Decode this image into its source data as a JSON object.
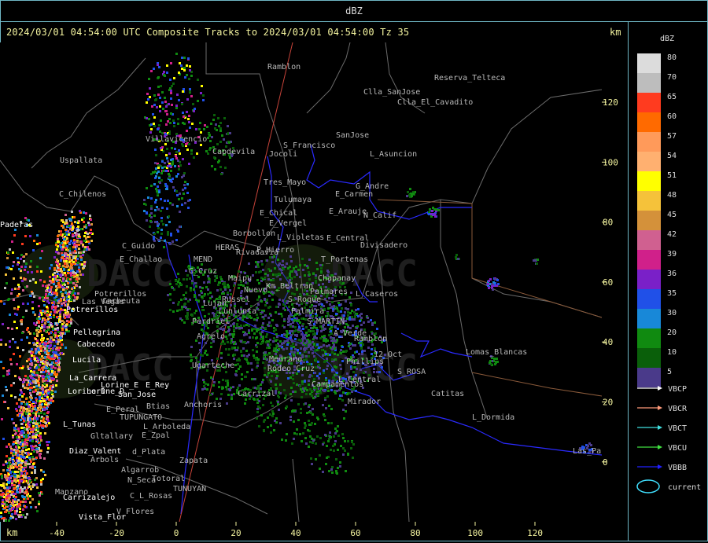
{
  "header": {
    "title": "dBZ"
  },
  "caption": "2024/03/01 04:54:00 UTC Composite Tracks to 2024/03/01 04:54:00 Tz 35",
  "units_top": "km",
  "units_bottom": "km",
  "axis_y_ticks": [
    "120",
    "100",
    "80",
    "60",
    "40",
    "20",
    "0"
  ],
  "axis_x_ticks": [
    "-40",
    "-20",
    "0",
    "20",
    "40",
    "60",
    "80",
    "100",
    "120"
  ],
  "legend": {
    "title": "dBZ",
    "scale": [
      {
        "label": "80",
        "color": "#dcdcdc"
      },
      {
        "label": "70",
        "color": "#bdbdbd"
      },
      {
        "label": "65",
        "color": "#ff3b1f"
      },
      {
        "label": "60",
        "color": "#ff6a00"
      },
      {
        "label": "57",
        "color": "#ff9a5a"
      },
      {
        "label": "54",
        "color": "#ffb070"
      },
      {
        "label": "51",
        "color": "#ffff00"
      },
      {
        "label": "48",
        "color": "#f5c23a"
      },
      {
        "label": "45",
        "color": "#d4913a"
      },
      {
        "label": "42",
        "color": "#d06090"
      },
      {
        "label": "39",
        "color": "#d0208a"
      },
      {
        "label": "36",
        "color": "#7a20c8"
      },
      {
        "label": "35",
        "color": "#2050e8"
      },
      {
        "label": "30",
        "color": "#1888d8"
      },
      {
        "label": "20",
        "color": "#108a10"
      },
      {
        "label": "10",
        "color": "#0a5f0a"
      },
      {
        "label": "5",
        "color": "#4a3a8a"
      }
    ],
    "tracks": [
      {
        "label": "VBCP",
        "color": "#ffffff"
      },
      {
        "label": "VBCR",
        "color": "#ff9a7a"
      },
      {
        "label": "VBCT",
        "color": "#40e0e0"
      },
      {
        "label": "VBCU",
        "color": "#40e040"
      },
      {
        "label": "VBBB",
        "color": "#2020ff"
      }
    ],
    "current": {
      "label": "current",
      "color": "#40e0ff"
    }
  },
  "watermarks": [
    {
      "text": "DACC",
      "sub1": "Direccion de Agricultura",
      "sub2": "y Contingencias Climaticas"
    },
    {
      "text": "DACC",
      "sub1": "Direccion de Agricultura",
      "sub2": "y Contingencias Climaticas"
    },
    {
      "text": "DACC",
      "sub1": "Direccion de Agricultura",
      "sub2": "y Contingencias Climaticas"
    },
    {
      "text": "DACC",
      "sub1": "Direccion de Agricultura",
      "sub2": "y Contingencias Climaticas"
    }
  ],
  "places_grey": [
    "Ramblon",
    "Reserva_Telteca",
    "Clla_SanJose",
    "Clla_El_Cavadito",
    "SanJose",
    "S_Francisco",
    "Jocoli",
    "L_Asuncion",
    "Uspallata",
    "Villavicencio",
    "Capdevila",
    "C_Chilenos",
    "Tres_Mayo",
    "G_Andre",
    "E_Carmen",
    "Tulumaya",
    "E_Chical",
    "E_Arauje",
    "N_Calif",
    "E_Vergel",
    "Borbollon",
    "L_Violetas",
    "E_Central",
    "Divisadero",
    "P_Hierro",
    "C_Guido",
    "E_Challao",
    "HERAS",
    "MEND",
    "G_Cruz",
    "T_Portenas",
    "Chapanay",
    "Km_Beltran",
    "Nuevo",
    "Palmares",
    "Maipu",
    "Russel",
    "Potrerillos",
    "Las_Vegas",
    "Cacheuta",
    "L_Caseros",
    "S_Roque",
    "Lunlunta",
    "Perdriel",
    "Palmira",
    "S_MARTIN",
    "Agrelo",
    "A_Verde",
    "Ramblon",
    "Phillips",
    "S_ROSA",
    "Lomas_Blancas",
    "12_Oct",
    "Ugarteche",
    "Medrano",
    "Rodeo_Cruz",
    "Campamentos",
    "L_Central",
    "Carrizal",
    "Mirador",
    "Catitas",
    "L_Dormida",
    "Anchoris",
    "E_Peral",
    "Btias",
    "TUPUNGATO",
    "L_Arboleda",
    "Gltallary",
    "E_Zpal",
    "d_Plata",
    "Zapata",
    "Arbols",
    "Algarrob",
    "N_Seca",
    "Totoral",
    "Manzano",
    "C_L_Rosas",
    "TUNUYAN",
    "V_Flores",
    "Las_Paz",
    "Rivadavia",
    "Lujan"
  ],
  "places_white": [
    "Potrerillos",
    "Pellegrina",
    "Cabecedo",
    "Lucila",
    "La_Carrera",
    "Lorine_D",
    "Lorine_E",
    "San_Jose",
    "L_Tunas",
    "Diaz_Valent",
    "Carrizalejo",
    "Vista_Flor",
    "Paderas",
    "E_Rey",
    "Lorine_D"
  ]
}
